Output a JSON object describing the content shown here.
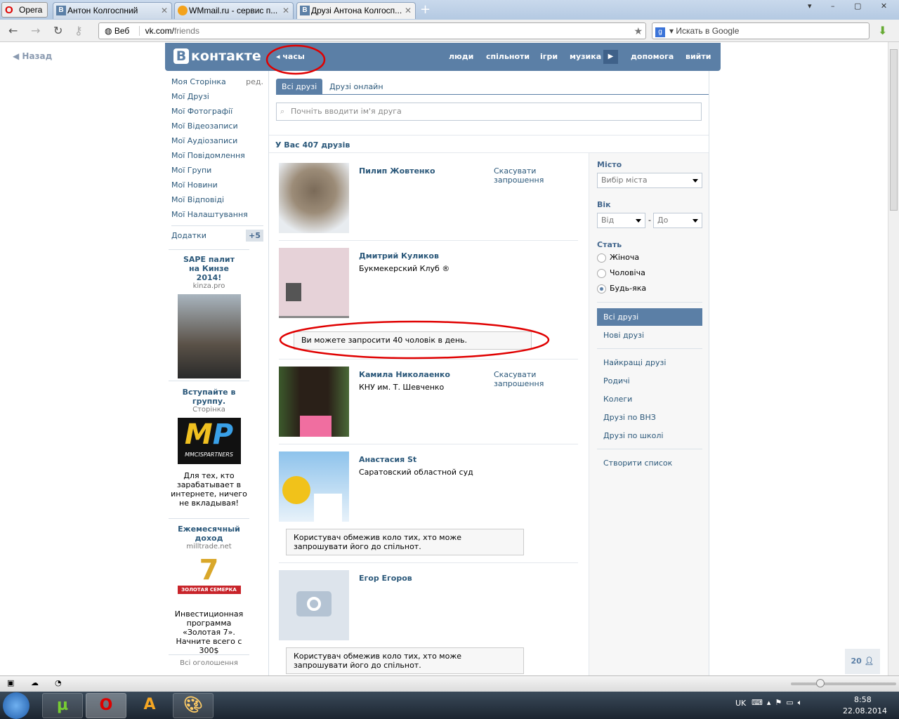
{
  "browser": {
    "opera_label": "Opera",
    "tabs": [
      {
        "label": "Антон Колгоспний"
      },
      {
        "label": "WMmail.ru - сервис п..."
      },
      {
        "label": "Друзі Антона Колгосп..."
      }
    ],
    "address_prefix": "Веб",
    "url_host": "vk.com/",
    "url_path": "friends",
    "search_placeholder": "Искать в Google"
  },
  "page": {
    "back_label": "Назад",
    "header": {
      "logo": "контакте",
      "logo_letter": "В",
      "back_link": "часы",
      "nav": [
        "люди",
        "спільноти",
        "ігри",
        "музика",
        "допомога",
        "вийти"
      ]
    },
    "left_nav": {
      "items": [
        "Моя Сторінка",
        "Мої Друзі",
        "Мої Фотографії",
        "Мої Відеозаписи",
        "Мої Аудіозаписи",
        "Мої Повідомлення",
        "Мої Групи",
        "Мої Новини",
        "Мої Відповіді",
        "Мої Налаштування"
      ],
      "edit": "ред.",
      "apps": "Додатки",
      "apps_badge": "+5"
    },
    "ads": [
      {
        "title": "SAPE палит на Кинзе 2014!",
        "source": "kinza.pro",
        "text": ""
      },
      {
        "title": "Вступайте в группу.",
        "source": "Сторінка",
        "image_text": "MMCISPARTNERS",
        "text": "Для тех, кто зарабатывает в интернете, ничего не вкладывая!"
      },
      {
        "title": "Ежемесячный доход",
        "source": "milltrade.net",
        "image_text": "ЗОЛОТАЯ СЕМЕРКА",
        "text": "Инвестиционная программа «Золотая 7». Начните всего с 300$"
      }
    ],
    "all_ads": "Всі оголошення",
    "tabs": [
      "Всі друзі",
      "Друзі онлайн"
    ],
    "search_placeholder": "Почніть вводити ім'я друга",
    "count": "У Вас 407 друзів",
    "friends": [
      {
        "name": "Пилип Жовтенко",
        "sub": "",
        "action": "Скасувати запрошення"
      },
      {
        "name": "Дмитрий Куликов",
        "sub": "Букмекерский Клуб ®",
        "action": ""
      },
      {
        "name": "Камила Николаенко",
        "sub": "КНУ им. Т. Шевченко",
        "action": "Скасувати запрошення"
      },
      {
        "name": "Анастасия St",
        "sub": "Саратовский областной суд",
        "action": ""
      },
      {
        "name": "Егор Егоров",
        "sub": "",
        "action": ""
      }
    ],
    "notices": [
      "Ви можете запросити 40 чоловік в день.",
      "Користувач обмежив коло тих, хто може запрошувати його до спільнот.",
      "Користувач обмежив коло тих, хто може запрошувати його до спільнот."
    ],
    "filters": {
      "city_label": "Місто",
      "city_select": "Вибір міста",
      "age_label": "Вік",
      "age_from": "Від",
      "age_to": "До",
      "dash": "-",
      "sex_label": "Стать",
      "sex_options": [
        "Жіноча",
        "Чоловіча",
        "Будь-яка"
      ],
      "sex_selected": "Будь-яка",
      "lists1": [
        "Всі друзі",
        "Нові друзі"
      ],
      "lists2": [
        "Найкращі друзі",
        "Родичі",
        "Колеги",
        "Друзі по ВНЗ",
        "Друзі по школі"
      ],
      "create": "Створити список"
    },
    "scroll_counter": "20"
  },
  "taskbar": {
    "lang": "UK",
    "time": "8:58",
    "date": "22.08.2014"
  },
  "colors": {
    "vk_blue": "#5b7fa6",
    "link": "#2b587a",
    "annotation": "#e00000"
  }
}
